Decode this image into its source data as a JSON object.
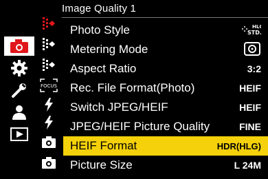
{
  "header": {
    "title": "Image Quality 1"
  },
  "menu": {
    "items": [
      {
        "label": "Photo Style",
        "value": "HLG STD.",
        "value_icon": "photo-style-hlg-std-icon"
      },
      {
        "label": "Metering Mode",
        "value": "",
        "value_icon": "multi-metering-icon"
      },
      {
        "label": "Aspect Ratio",
        "value": "3:2"
      },
      {
        "label": "Rec. File Format(Photo)",
        "value": "HEIF"
      },
      {
        "label": "Switch JPEG/HEIF",
        "value": "HEIF"
      },
      {
        "label": "JPEG/HEIF Picture Quality",
        "value": "FINE"
      },
      {
        "label": "HEIF Format",
        "value": "HDR(HLG)",
        "selected": true
      },
      {
        "label": "Picture Size",
        "value": "L 24M"
      }
    ]
  },
  "sidebar": {
    "categories": [
      {
        "icon": "camera-icon",
        "active": true
      },
      {
        "icon": "gear-icon"
      },
      {
        "icon": "wrench-icon"
      },
      {
        "icon": "person-icon"
      },
      {
        "icon": "playback-icon"
      }
    ],
    "subtabs": [
      {
        "icon": "image-quality-red-icon"
      },
      {
        "icon": "image-quality-white-icon"
      },
      {
        "icon": "image-quality-white-icon"
      },
      {
        "icon": "focus-icon"
      },
      {
        "icon": "flash-icon"
      },
      {
        "icon": "flash-icon"
      },
      {
        "icon": "camera-small-icon"
      },
      {
        "icon": "camera-small-icon"
      }
    ]
  },
  "colors": {
    "accent": "#e0161b",
    "highlight": "#f4d10a",
    "background": "#000000"
  }
}
